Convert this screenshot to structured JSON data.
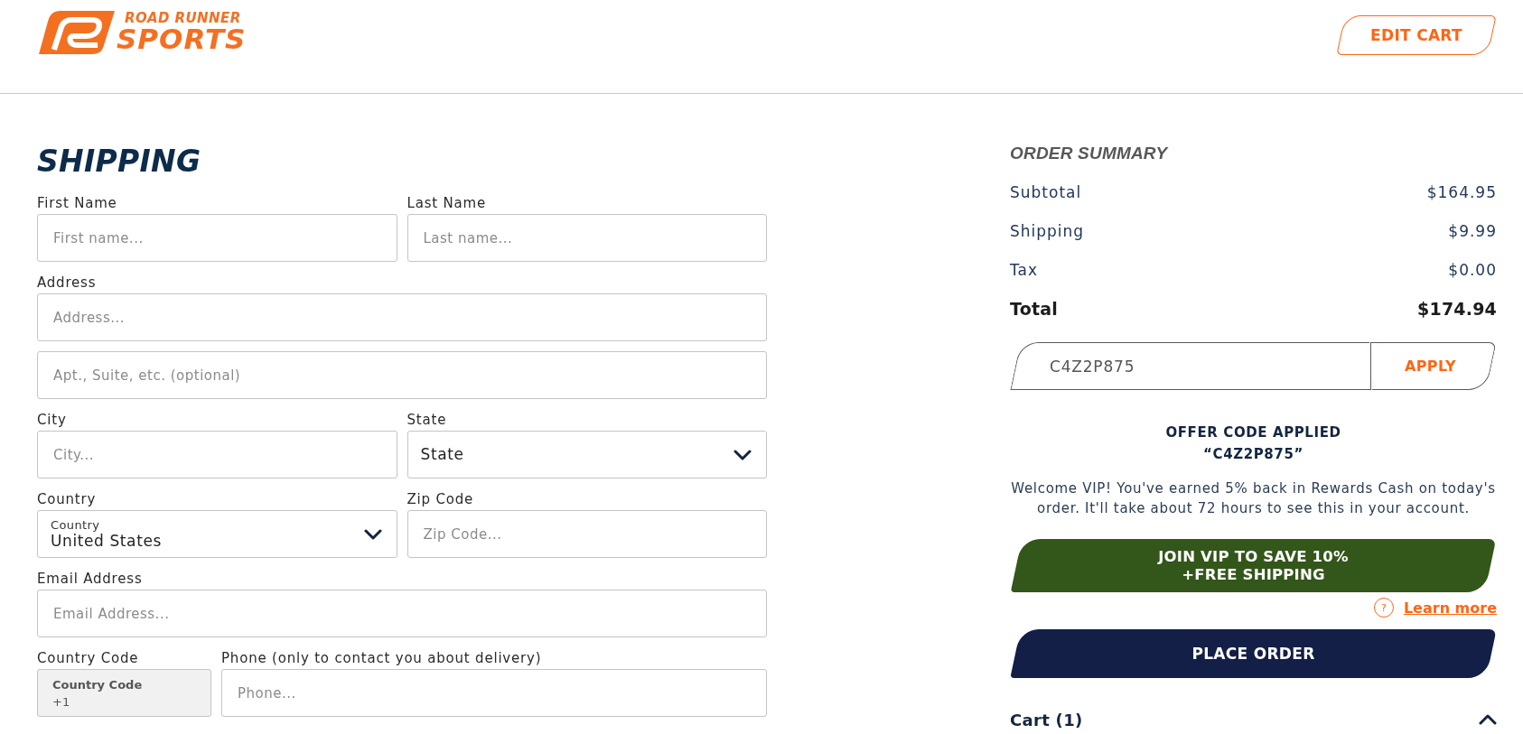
{
  "header": {
    "logo": {
      "lines": [
        "ROAD RUNNER",
        "SPORTS"
      ]
    },
    "edit_cart_button": "EDIT CART"
  },
  "shipping": {
    "title": "SHIPPING",
    "rows": [
      {
        "fields": [
          {
            "kind": "text",
            "label": "First Name",
            "placeholder": "First name...",
            "disabled": false
          },
          {
            "kind": "text",
            "label": "Last Name",
            "placeholder": "Last name...",
            "disabled": false
          }
        ]
      },
      {
        "fields": [
          {
            "kind": "text",
            "label": "Address",
            "placeholder": "Address...",
            "disabled": false
          }
        ]
      },
      {
        "fields": [
          {
            "kind": "text",
            "placeholder": "Apt., Suite, etc. (optional)",
            "disabled": false
          }
        ]
      },
      {
        "fields": [
          {
            "kind": "text",
            "label": "City",
            "placeholder": "City...",
            "disabled": false
          },
          {
            "kind": "select",
            "label": "State",
            "value": "State",
            "disabled": false
          }
        ]
      },
      {
        "fields": [
          {
            "kind": "select",
            "label": "Country",
            "floating_label": "Country",
            "value": "United States",
            "disabled": false
          },
          {
            "kind": "text",
            "label": "Zip Code",
            "placeholder": "Zip Code...",
            "disabled": false
          }
        ]
      },
      {
        "fields": [
          {
            "kind": "text",
            "label": "Email Address",
            "placeholder": "Email Address...",
            "disabled": false
          }
        ]
      },
      {
        "fields": [
          {
            "kind": "country_code",
            "label": "Country Code",
            "floating_label": "Country Code",
            "value": "+1",
            "disabled": true
          },
          {
            "kind": "text",
            "label": "Phone (only to contact you about delivery)",
            "placeholder": "Phone...",
            "disabled": false
          }
        ]
      }
    ]
  },
  "order_summary": {
    "title": "ORDER SUMMARY",
    "lines": [
      {
        "kind": "line",
        "label": "Subtotal",
        "value": "$164.95"
      },
      {
        "kind": "line",
        "label": "Shipping",
        "value": "$9.99"
      },
      {
        "kind": "line",
        "label": "Tax",
        "value": "$0.00"
      },
      {
        "kind": "total",
        "label": "Total",
        "value": "$174.94"
      }
    ],
    "promo": {
      "value": "C4Z2P875",
      "button": "APPLY"
    },
    "offer": {
      "title": "OFFER CODE APPLIED",
      "code": "“C4Z2P875”"
    },
    "message": "Welcome VIP! You've earned 5% back in Rewards Cash on today's order. It'll take about 72 hours to see this in your account.",
    "vip_button": {
      "lines": [
        "JOIN VIP TO SAVE 10%",
        "+FREE SHIPPING"
      ]
    },
    "learn_more": {
      "icon": "?",
      "label": "Learn more"
    },
    "place_order_button": "PLACE ORDER",
    "cart": {
      "label": "Cart (1)",
      "expanded": true
    }
  }
}
